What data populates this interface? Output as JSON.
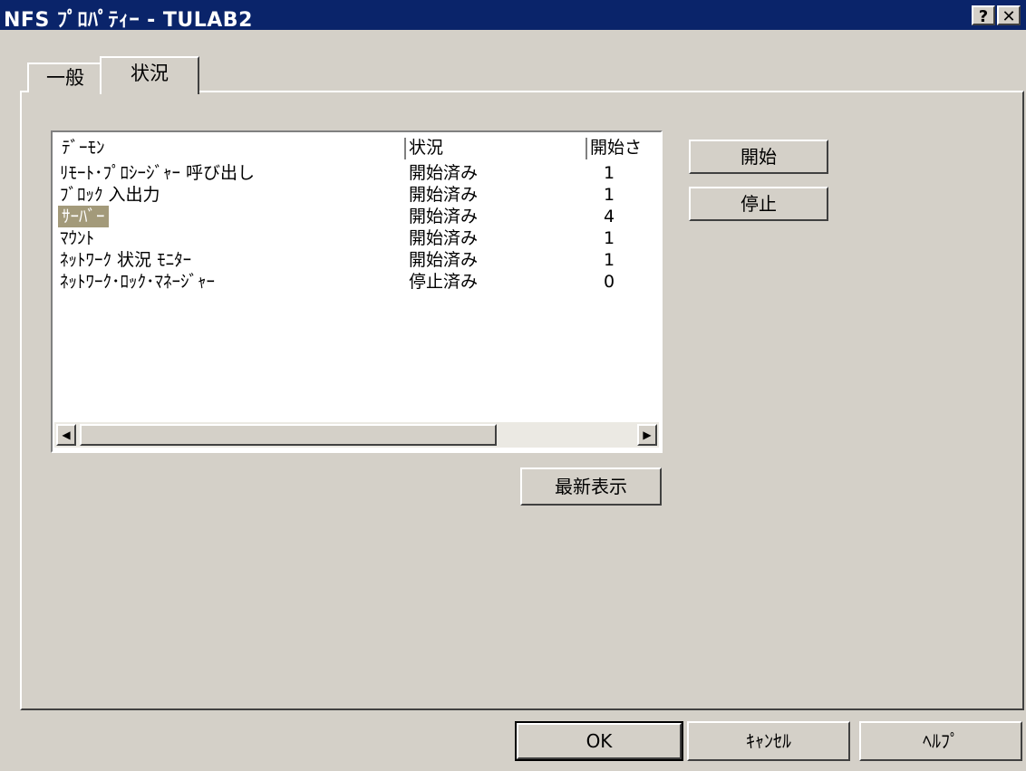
{
  "window": {
    "title": "NFS ﾌﾟﾛﾊﾟﾃｨｰ - TULAB2",
    "help_label": "?",
    "close_label": "✕"
  },
  "tabs": [
    {
      "label": "一般",
      "active": false
    },
    {
      "label": "状況",
      "active": true
    }
  ],
  "list": {
    "columns": [
      "ﾃﾞｰﾓﾝ",
      "状況",
      "開始さ"
    ],
    "rows": [
      {
        "name": "ﾘﾓｰﾄ･ﾌﾟﾛｼｰｼﾞｬｰ 呼び出し",
        "status": "開始済み",
        "count": "1",
        "selected": false
      },
      {
        "name": "ﾌﾞﾛｯｸ 入出力",
        "status": "開始済み",
        "count": "1",
        "selected": false
      },
      {
        "name": "ｻｰﾊﾞｰ",
        "status": "開始済み",
        "count": "4",
        "selected": true
      },
      {
        "name": "ﾏｳﾝﾄ",
        "status": "開始済み",
        "count": "1",
        "selected": false
      },
      {
        "name": "ﾈｯﾄﾜｰｸ 状況 ﾓﾆﾀｰ",
        "status": "開始済み",
        "count": "1",
        "selected": false
      },
      {
        "name": "ﾈｯﾄﾜｰｸ･ﾛｯｸ･ﾏﾈｰｼﾞｬｰ",
        "status": "停止済み",
        "count": "0",
        "selected": false
      }
    ]
  },
  "buttons": {
    "start": "開始",
    "stop": "停止",
    "refresh": "最新表示",
    "ok": "OK",
    "cancel": "ｷｬﾝｾﾙ",
    "help": "ﾍﾙﾌﾟ"
  },
  "colors": {
    "titlebar": "#0a246a",
    "face": "#d4d0c8",
    "selection": "#a39a7a"
  }
}
